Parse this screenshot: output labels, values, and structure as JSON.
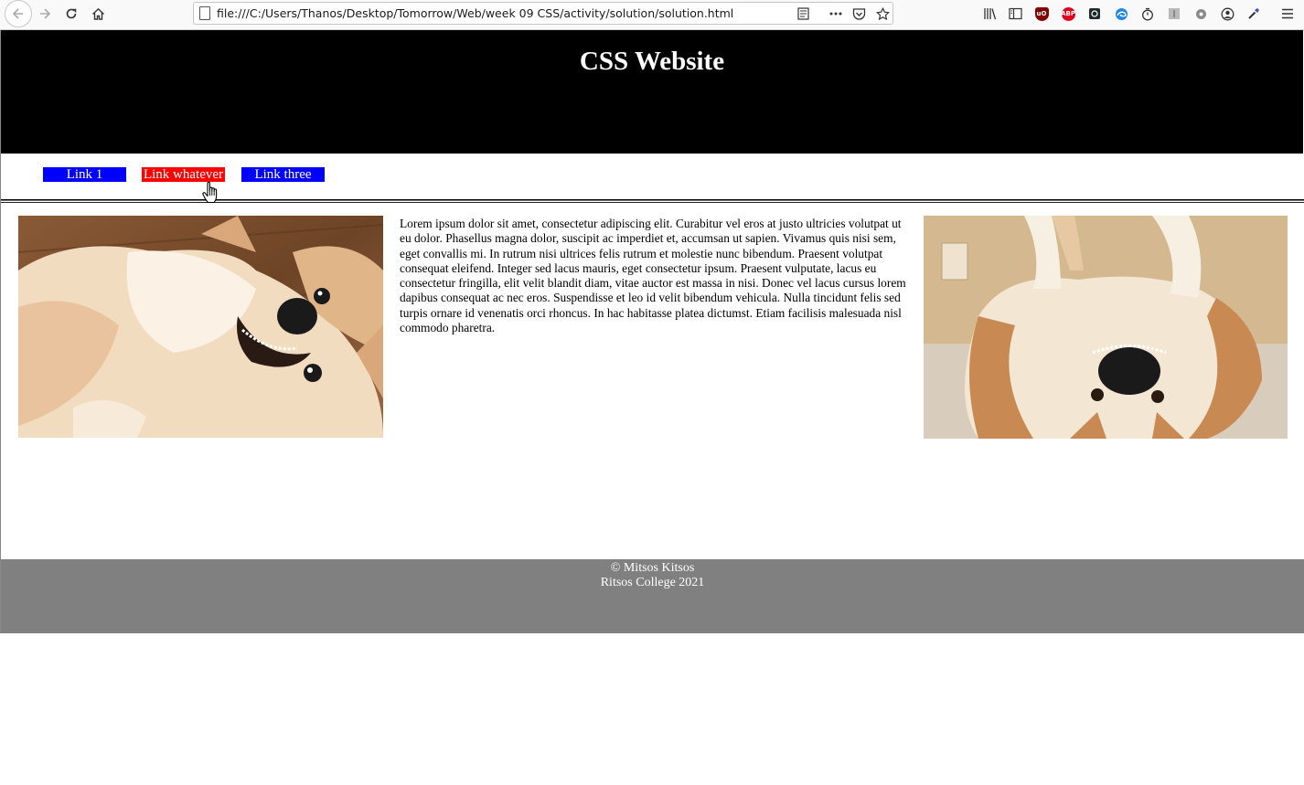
{
  "browser": {
    "url": "file:///C:/Users/Thanos/Desktop/Tomorrow/Web/week 09 CSS/activity/solution/solution.html",
    "nav_icons": [
      "back-arrow-icon",
      "forward-arrow-icon",
      "reload-icon",
      "home-icon"
    ],
    "url_actions": [
      "reader-view-icon",
      "more-actions-icon",
      "pocket-icon",
      "bookmark-star-icon"
    ],
    "extensions": [
      "library-icon",
      "sidebar-icon",
      "ublock-icon",
      "adblock-plus-icon",
      "screen-capture-icon",
      "edge-icon",
      "timer-icon",
      "extension-gray-icon",
      "settings-gear-icon",
      "account-icon",
      "eyedropper-icon",
      "menu-icon"
    ],
    "extension_labels": {
      "ublock": "uO",
      "abp": "ABP"
    }
  },
  "site": {
    "title": "CSS Website",
    "nav": [
      {
        "label": "Link 1",
        "state": "normal"
      },
      {
        "label": "Link whatever",
        "state": "hover"
      },
      {
        "label": "Link three",
        "state": "normal"
      }
    ],
    "nav_colors": {
      "normal": "#0000ff",
      "hover": "#ff0000"
    },
    "header_bg": "#000000",
    "footer_bg": "#808080",
    "body_text": "Lorem ipsum dolor sit amet, consectetur adipiscing elit. Curabitur vel eros at justo ultricies volutpat ut eu dolor. Phasellus magna dolor, suscipit ac imperdiet et, accumsan ut sapien. Vivamus quis nisi sem, eget convallis mi. In rutrum nisi ultrices felis rutrum et molestie nunc bibendum. Praesent volutpat consequat eleifend. Integer sed lacus mauris, eget consectetur ipsum. Praesent vulputate, lacus eu consectetur fringilla, elit velit blandit diam, vitae auctor est massa in nisi. Donec vel lacus cursus lorem dapibus consequat ac nec eros. Suspendisse et leo id velit bibendum vehicula. Nulla tincidunt felis sed turpis ornare id venenatis orci rhoncus. In hac habitasse platea dictumst. Etiam facilisis malesuada nisl commodo pharetra.",
    "footer": {
      "copyright": "© Mitsos Kitsos",
      "college": "Ritsos College 2021"
    }
  }
}
